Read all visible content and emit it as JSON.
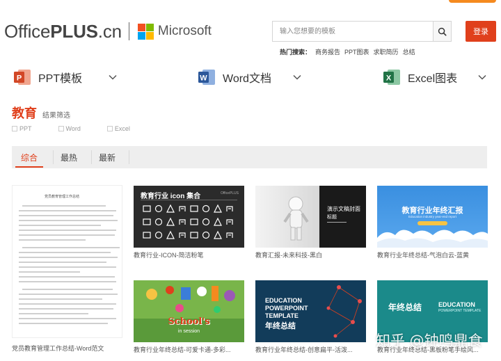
{
  "header": {
    "logo_office": "Office",
    "logo_plus": "PLUS",
    "logo_cn": ".cn",
    "microsoft": "Microsoft",
    "search_placeholder": "输入您想要的模板",
    "login_label": "登录",
    "hot_label": "热门搜索：",
    "hot_items": [
      "商务报告",
      "PPT图表",
      "求职简历",
      "总结"
    ]
  },
  "categories": [
    {
      "label": "PPT模板",
      "icon": "powerpoint-icon",
      "color": "#d24726",
      "letter": "P"
    },
    {
      "label": "Word文档",
      "icon": "word-icon",
      "color": "#2b579a",
      "letter": "W"
    },
    {
      "label": "Excel图表",
      "icon": "excel-icon",
      "color": "#217346",
      "letter": "X"
    }
  ],
  "page": {
    "title": "教育",
    "result_label": "结果筛选"
  },
  "filters": [
    "PPT",
    "Word",
    "Excel"
  ],
  "tabs": [
    {
      "label": "综合",
      "active": true
    },
    {
      "label": "最热",
      "active": false
    },
    {
      "label": "最新",
      "active": false
    }
  ],
  "cards": [
    {
      "label": "党员教育管理工作总结-Word范文"
    },
    {
      "label": "教育行业-ICON-简洁粉笔",
      "thumb_title": "教育行业 icon 集合",
      "thumb_brand": "OfficePLUS"
    },
    {
      "label": "教育汇报-未来科技-黑白",
      "thumb_title": "演示文稿封面",
      "thumb_sub": "标题"
    },
    {
      "label": "教育行业年终总结-气泡白云-蓝黄",
      "thumb_title": "教育行业年终汇报",
      "thumb_sub": "Education industry year-end report"
    },
    {
      "label": "教育行业年终总结-可爱卡通-多彩...",
      "thumb_title": "School's",
      "thumb_sub": "in session"
    },
    {
      "label": "教育行业年终总结-创意扁平-活泼...",
      "thumb_title": "EDUCATION",
      "thumb_sub": "POWERPOINT",
      "thumb_sub2": "TEMPLATE",
      "thumb_cn": "年终总结"
    },
    {
      "label": "教育行业年终总结-黑板粉笔手绘风...",
      "thumb_title": "年终总结",
      "thumb_sub": "EDUCATION",
      "thumb_sub2": "POWERPOINT TEMPLATE"
    }
  ],
  "doc_thumb_heading": "党员教育管理工作总结",
  "watermark": "知乎 @钟鸣鼎食",
  "colors": {
    "accent": "#e0401c",
    "tab_bar": "#eeeeee"
  }
}
